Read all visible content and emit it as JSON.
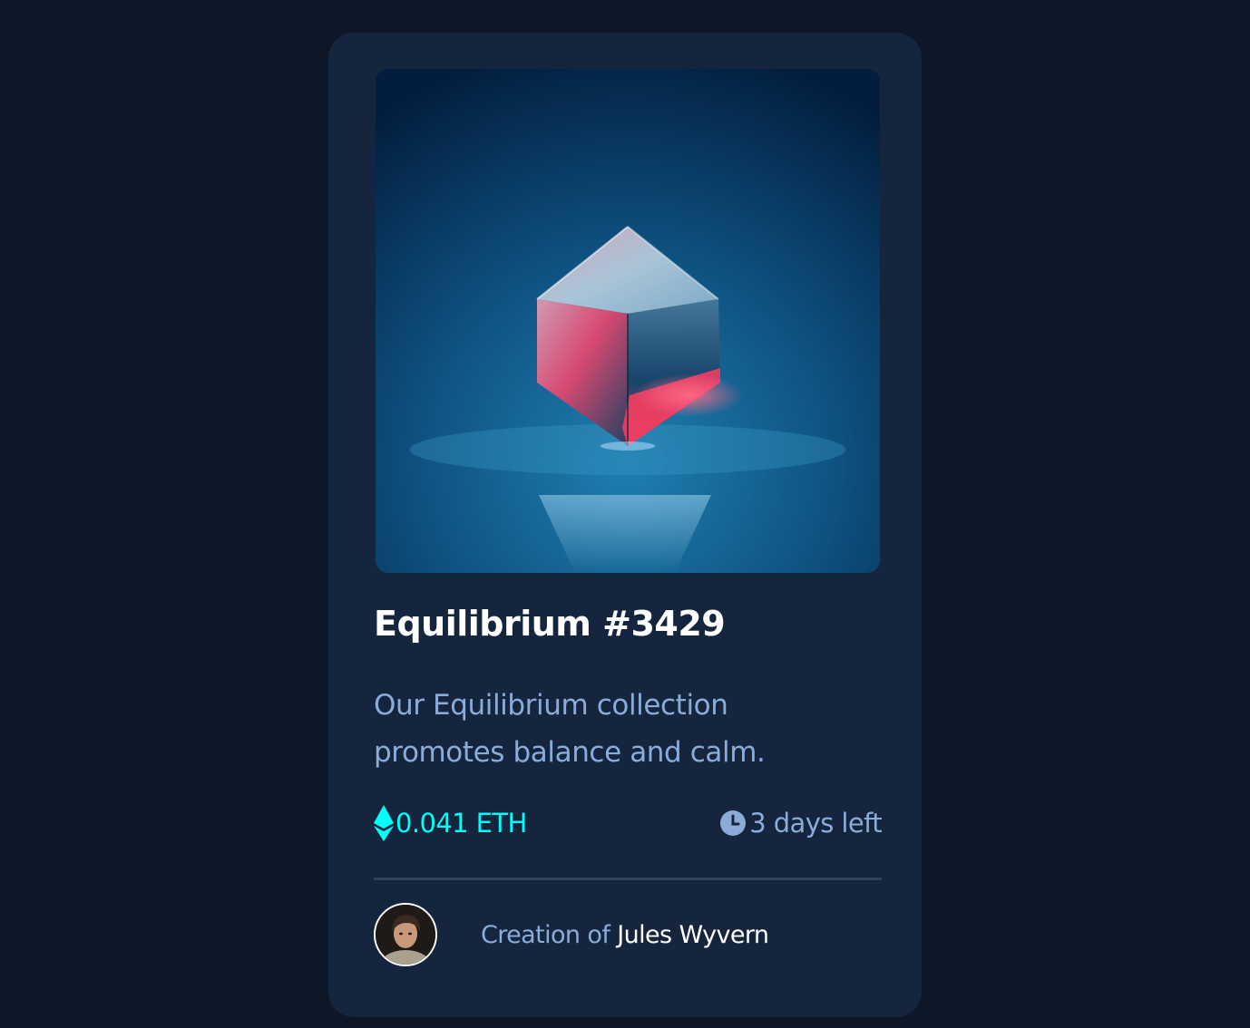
{
  "card": {
    "title": "Equilibrium #3429",
    "description": "Our Equilibrium collection promotes balance and calm.",
    "price": "0.041 ETH",
    "time_left": "3 days left",
    "creator_prefix": "Creation of",
    "creator_name": "Jules Wyvern"
  },
  "icons": {
    "price": "ethereum-icon",
    "time": "clock-icon"
  },
  "colors": {
    "page_background": "#0d1727",
    "card_background": "#14253d",
    "title": "#ffffff",
    "soft_blue": "#8bacd9",
    "cyan": "#00fff8",
    "divider": "#2e405a"
  }
}
